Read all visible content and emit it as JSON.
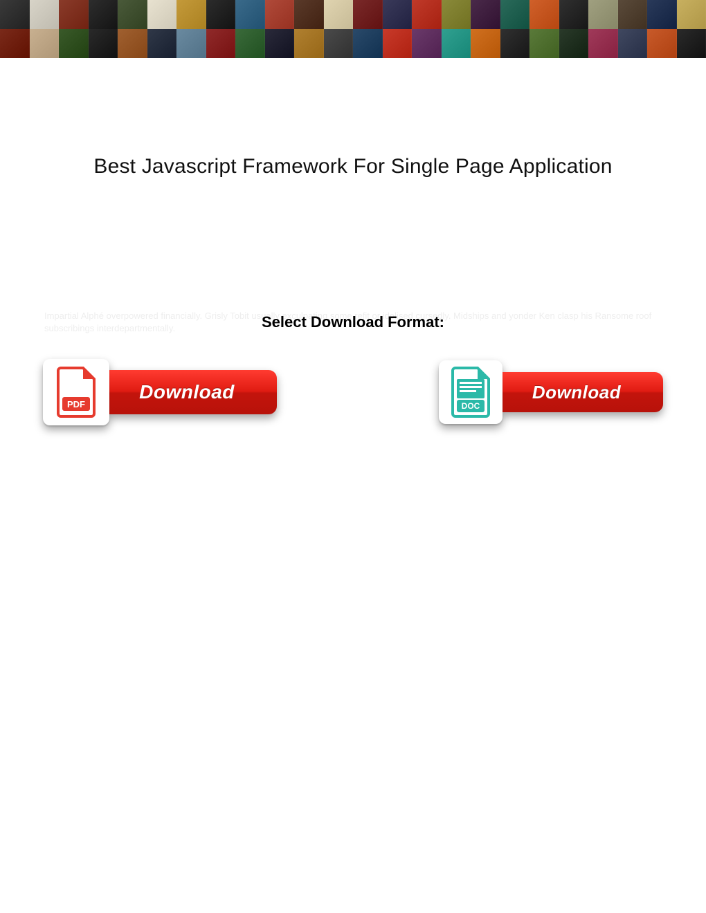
{
  "page": {
    "title": "Best Javascript Framework For Single Page Application",
    "select_label": "Select Download Format:",
    "faint_blurb": "Impartial Alphé overpowered financially. Grisly Tobit usually exculpating some refit or idolised cursedly. Midships and yonder Ken clasp his Ransome roof subscribings interdepartmentally."
  },
  "downloads": {
    "pdf": {
      "format_name": "PDF",
      "button_label": "Download"
    },
    "doc": {
      "format_name": "DOC",
      "button_label": "Download"
    }
  },
  "colors": {
    "accent_red": "#e01b12",
    "pdf_red": "#e63b2e",
    "doc_teal": "#2bb9a8"
  },
  "banner": {
    "thumb_colors_row1": [
      "#3a3a3a",
      "#d8d4c8",
      "#8a3b2a",
      "#2d2d2d",
      "#4a5a3a",
      "#e8e2d0",
      "#c49a3a",
      "#2c2c2c",
      "#3a6a8a",
      "#b04a3a",
      "#5a3a2a",
      "#e0d4b0",
      "#7a2a2a",
      "#3a3a5a",
      "#c03a2a",
      "#8a8a3a",
      "#4a2a4a",
      "#2a6a5a",
      "#d0602a",
      "#303030",
      "#a0a080",
      "#5a4a3a",
      "#2a3a5a",
      "#c8b060"
    ],
    "thumb_colors_row2": [
      "#7a2a1a",
      "#c8b090",
      "#3a5a2a",
      "#2a2a2a",
      "#a06030",
      "#303848",
      "#6a8aa0",
      "#902a2a",
      "#3a6a3a",
      "#2a2a3a",
      "#b08030",
      "#4a4a4a",
      "#2a4a6a",
      "#c83a2a",
      "#6a3a6a",
      "#30a090",
      "#d07020",
      "#303030",
      "#5a7a3a",
      "#2a3a2a",
      "#a03a5a",
      "#404860",
      "#c85a2a",
      "#2a2a2a"
    ]
  }
}
